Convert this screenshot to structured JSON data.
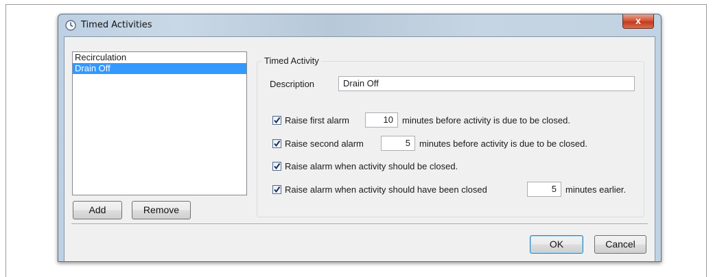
{
  "window": {
    "title": "Timed Activities",
    "close_glyph": "x"
  },
  "list": {
    "items": [
      "Recirculation",
      "Drain Off"
    ],
    "selected_index": 1
  },
  "buttons": {
    "add": "Add",
    "remove": "Remove",
    "ok": "OK",
    "cancel": "Cancel"
  },
  "group": {
    "title": "Timed Activity",
    "description_label": "Description",
    "description_value": "Drain Off"
  },
  "alarms": {
    "first": {
      "checked": true,
      "label": "Raise first alarm",
      "value": "10",
      "suffix": "minutes before activity is due to be closed."
    },
    "second": {
      "checked": true,
      "label": "Raise second alarm",
      "value": "5",
      "suffix": "minutes before activity is due to be closed."
    },
    "closed": {
      "checked": true,
      "label": "Raise alarm when activity should be closed."
    },
    "overdue": {
      "checked": true,
      "label": "Raise alarm when activity should have been closed",
      "value": "5",
      "suffix": "minutes earlier."
    }
  },
  "icons": {
    "title": "clock-icon",
    "close": "close-icon",
    "check": "checkmark-icon"
  }
}
